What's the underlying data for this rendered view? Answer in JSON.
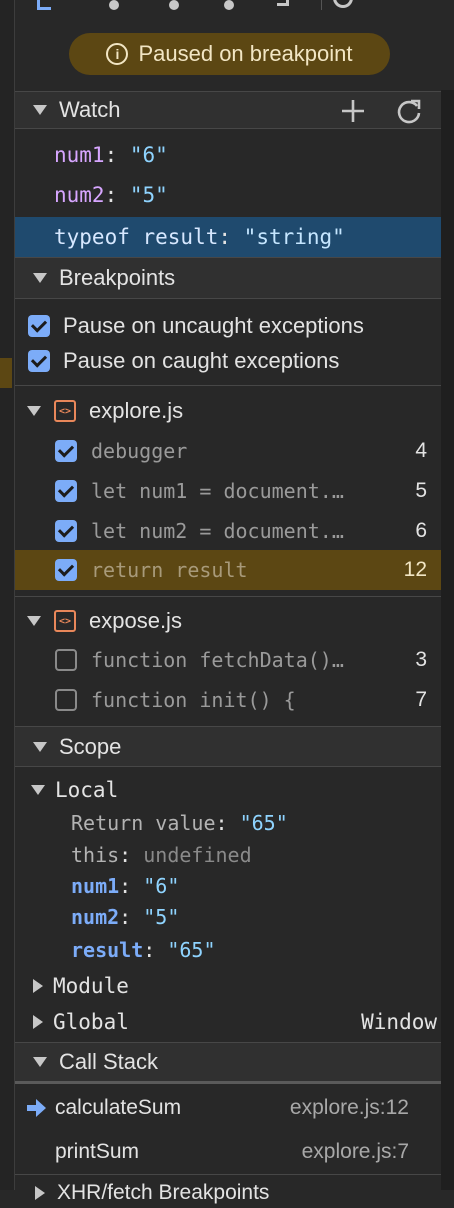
{
  "status": {
    "paused_text": "Paused on breakpoint"
  },
  "watch": {
    "title": "Watch",
    "items": [
      {
        "name": "num1",
        "value": "\"6\""
      },
      {
        "name": "num2",
        "value": "\"5\""
      },
      {
        "name": "typeof result",
        "value": "\"string\""
      }
    ]
  },
  "breakpoints": {
    "title": "Breakpoints",
    "options": [
      {
        "label": "Pause on uncaught exceptions",
        "checked": true
      },
      {
        "label": "Pause on caught exceptions",
        "checked": true
      }
    ],
    "files": [
      {
        "name": "explore.js",
        "items": [
          {
            "code": "debugger",
            "line": "4",
            "checked": true
          },
          {
            "code": "let num1 = document.…",
            "line": "5",
            "checked": true
          },
          {
            "code": "let num2 = document.…",
            "line": "6",
            "checked": true
          },
          {
            "code": "return result",
            "line": "12",
            "checked": true,
            "active": true
          }
        ]
      },
      {
        "name": "expose.js",
        "items": [
          {
            "code": "function fetchData()…",
            "line": "3",
            "checked": false
          },
          {
            "code": "function init() {",
            "line": "7",
            "checked": false
          }
        ]
      }
    ]
  },
  "scope": {
    "title": "Scope",
    "local_label": "Local",
    "local": [
      {
        "key": "Return value",
        "value": "\"65\""
      },
      {
        "key": "this",
        "value": "undefined"
      },
      {
        "key": "num1",
        "value": "\"6\""
      },
      {
        "key": "num2",
        "value": "\"5\""
      },
      {
        "key": "result",
        "value": "\"65\""
      }
    ],
    "module_label": "Module",
    "global_label": "Global",
    "global_value": "Window"
  },
  "call_stack": {
    "title": "Call Stack",
    "frames": [
      {
        "fn": "calculateSum",
        "loc": "explore.js:12",
        "current": true
      },
      {
        "fn": "printSum",
        "loc": "explore.js:7",
        "current": false
      }
    ]
  },
  "next_section": {
    "title": "XHR/fetch Breakpoints"
  },
  "colors": {
    "paused_bg": "#5c4713",
    "selected_row": "#1f4a6e",
    "checkbox": "#7cacf8"
  }
}
